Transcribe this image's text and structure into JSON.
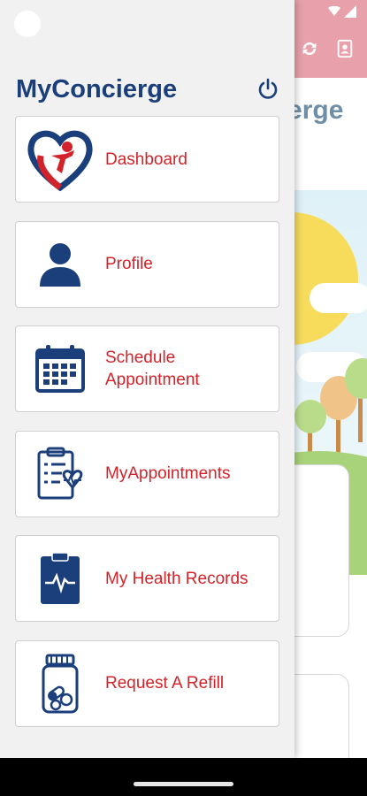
{
  "background": {
    "title_fragment": "cierge",
    "header_icons": [
      "sync-icon",
      "contacts-icon"
    ]
  },
  "drawer": {
    "app_title": "MyConcierge",
    "power_icon": "power-icon",
    "items": [
      {
        "label": "Dashboard",
        "icon": "heart-person-logo-icon"
      },
      {
        "label": "Profile",
        "icon": "person-icon"
      },
      {
        "label": "Schedule\nAppointment",
        "icon": "calendar-icon"
      },
      {
        "label": "MyAppointments",
        "icon": "clipboard-checklist-icon"
      },
      {
        "label": "My Health Records",
        "icon": "clipboard-heartbeat-icon"
      },
      {
        "label": "Request A Refill",
        "icon": "pill-bottle-icon"
      }
    ]
  },
  "colors": {
    "title": "#1b3f7a",
    "label": "#d2232a",
    "appbar": "#e8a0ab"
  }
}
